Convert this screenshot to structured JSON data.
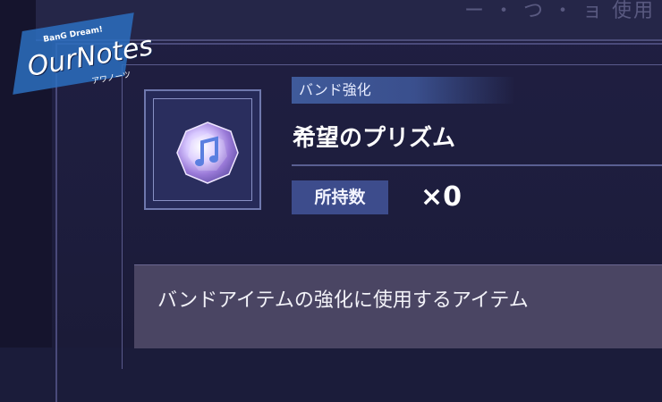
{
  "logo": {
    "small_text": "BanG Dream!",
    "big_text": "OurNotes",
    "kana_text": "アワノーツ"
  },
  "header": {
    "title_fragment": "ー ・ つ ・ ョ 使用"
  },
  "item": {
    "icon_name": "prism-gem-icon",
    "category": "バンド強化",
    "name": "希望のプリズム",
    "owned_label": "所持数",
    "owned_count": "×0",
    "description": "バンドアイテムの強化に使用するアイテム"
  },
  "colors": {
    "accent": "#3d4c8c",
    "panel": "#4a4563",
    "background": "#1d1d3d"
  }
}
